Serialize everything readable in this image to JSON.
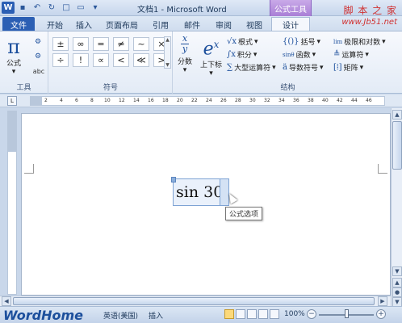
{
  "title_bar": {
    "title": "文档1 - Microsoft Word",
    "context_tab_group": "公式工具",
    "watermark": "脚 本 之 家"
  },
  "tabs": [
    {
      "label": "文件"
    },
    {
      "label": "开始"
    },
    {
      "label": "插入"
    },
    {
      "label": "页面布局"
    },
    {
      "label": "引用"
    },
    {
      "label": "邮件"
    },
    {
      "label": "审阅"
    },
    {
      "label": "视图"
    },
    {
      "label": "设计"
    }
  ],
  "watermark_url": "www.Jb51.net",
  "ribbon": {
    "tools_group": {
      "label": "工具",
      "equation_button": "公式",
      "pi_symbol": "π",
      "abc_label": "abc"
    },
    "symbols_group": {
      "label": "符号",
      "symbols": [
        "±",
        "∞",
        "=",
        "≠",
        "~",
        "×",
        "÷",
        "!",
        "∝",
        "<",
        "≪",
        ">"
      ]
    },
    "structures_group": {
      "label": "结构",
      "fraction": "分数",
      "script": "上下标",
      "radical": "根式",
      "integral": "积分",
      "large_operator": "大型运算符",
      "bracket": "括号",
      "function": "函数",
      "accent": "导数符号",
      "limit_log": "极限和对数",
      "operator": "运算符",
      "matrix": "矩阵"
    }
  },
  "ruler_ticks": [
    "2",
    "4",
    "6",
    "8",
    "10",
    "12",
    "14",
    "16",
    "18",
    "20",
    "22",
    "24",
    "26",
    "28",
    "30",
    "32",
    "34",
    "36",
    "38",
    "40",
    "42",
    "44",
    "46"
  ],
  "document": {
    "equation_text": "sin 30",
    "tooltip": "公式选项"
  },
  "status_bar": {
    "brand": "WordHome",
    "language": "英语(美国)",
    "mode": "插入",
    "zoom": "100%"
  }
}
